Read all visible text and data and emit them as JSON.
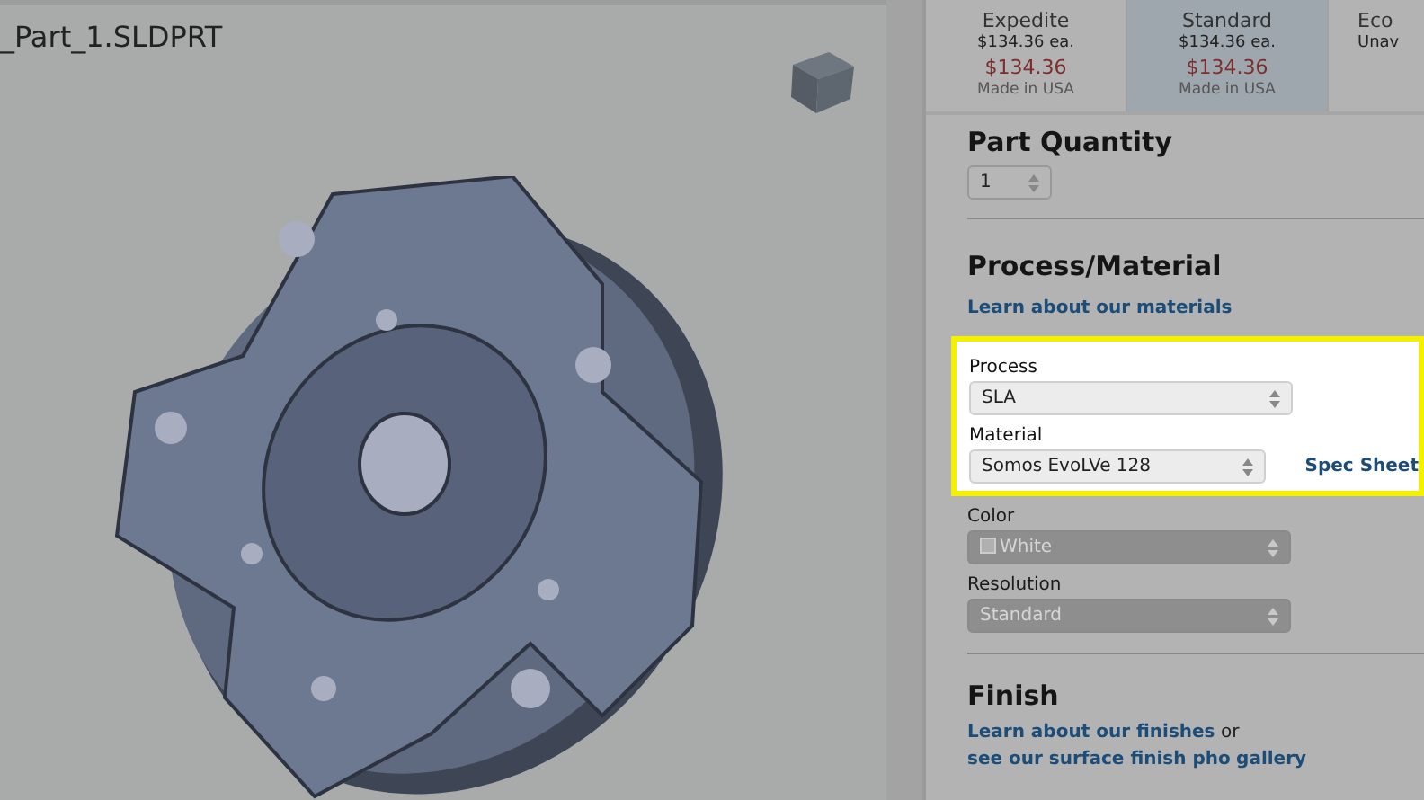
{
  "viewer": {
    "filename": "_Part_1.SLDPRT"
  },
  "shipping_options": [
    {
      "name": "Expedite",
      "unit_price": "$134.36 ea.",
      "total": "$134.36",
      "origin": "Made in USA",
      "selected": false
    },
    {
      "name": "Standard",
      "unit_price": "$134.36 ea.",
      "total": "$134.36",
      "origin": "Made in USA",
      "selected": true
    },
    {
      "name": "Eco",
      "unit_price": "Unav",
      "selected": false
    }
  ],
  "part_quantity": {
    "title": "Part Quantity",
    "value": "1"
  },
  "process_material": {
    "title": "Process/Material",
    "link": "Learn about our materials",
    "fields": [
      {
        "label": "Process",
        "value": "SLA",
        "disabled": false,
        "highlighted": true
      },
      {
        "label": "Material",
        "value": "Somos EvoLVe 128",
        "disabled": false,
        "highlighted": true,
        "side_link": "Spec Sheet"
      },
      {
        "label": "Color",
        "value": "White",
        "disabled": true,
        "highlighted": false,
        "swatch": true
      },
      {
        "label": "Resolution",
        "value": "Standard",
        "disabled": true,
        "highlighted": false
      }
    ]
  },
  "finish": {
    "title": "Finish",
    "link_1": "Learn about our finishes",
    "connector": "or",
    "link_2": "see our surface finish pho",
    "link_3": "gallery"
  }
}
